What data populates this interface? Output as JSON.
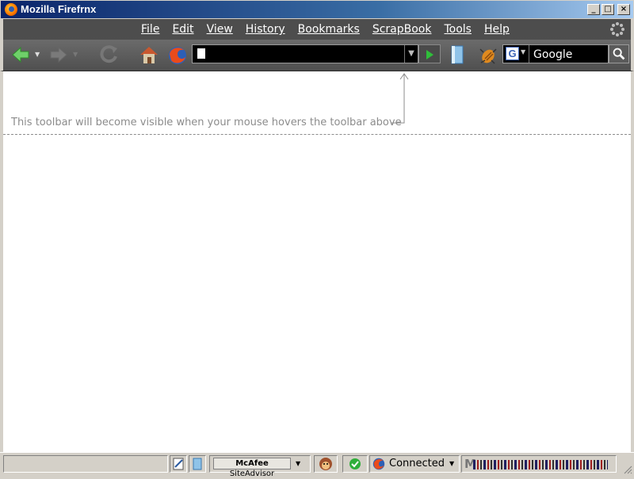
{
  "window": {
    "title": "Mozilla Firefrnx",
    "controls": [
      "minimize",
      "maximize",
      "close"
    ]
  },
  "menu": {
    "items": [
      "File",
      "Edit",
      "View",
      "History",
      "Bookmarks",
      "ScrapBook",
      "Tools",
      "Help"
    ]
  },
  "navbar": {
    "url_value": "",
    "search_engine": "G",
    "search_value": "Google"
  },
  "content": {
    "hint": "This toolbar will become visible when your mouse hovers the toolbar above"
  },
  "statusbar": {
    "mcafee_brand": "McAfee",
    "mcafee_product": "SiteAdvisor",
    "connection_status": "Connected",
    "gmail_letter": "M"
  },
  "colors": {
    "toolbar_dark": "#4d4d4d",
    "go_green": "#2fbf3a",
    "hint_gray": "#8c8c8c"
  }
}
